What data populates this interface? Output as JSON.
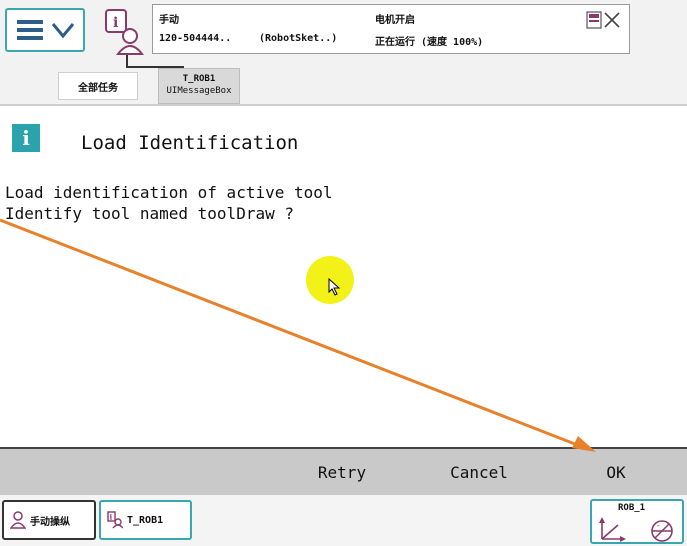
{
  "header": {
    "status": {
      "mode": "手动",
      "controller_id": "120-504444..",
      "system_name": "(RobotSket..)",
      "motor_state": "电机开启",
      "run_state": "正在运行 (速度 100%)"
    }
  },
  "tabs": [
    {
      "label": "全部任务"
    },
    {
      "label": "T_ROB1",
      "sublabel": "UIMessageBox"
    }
  ],
  "dialog": {
    "title": "Load Identification",
    "info_icon_glyph": "i",
    "messages": [
      "Load identification of active tool",
      "Identify tool named toolDraw ?"
    ]
  },
  "buttons": {
    "retry": "Retry",
    "cancel": "Cancel",
    "ok": "OK"
  },
  "taskbar": {
    "jog_label": "手动操纵",
    "task_label": "T_ROB1",
    "mech_unit": "ROB_1"
  },
  "colors": {
    "accent_teal": "#2aa3ad",
    "annotation_arrow": "#e8812b",
    "cursor_highlight": "#f2f218"
  },
  "icons": [
    "menu-icon",
    "chevron-down-icon",
    "info-user-icon",
    "close-icon",
    "info-icon",
    "jog-icon",
    "task-icon",
    "coordinate-icon",
    "incremental-icon"
  ]
}
